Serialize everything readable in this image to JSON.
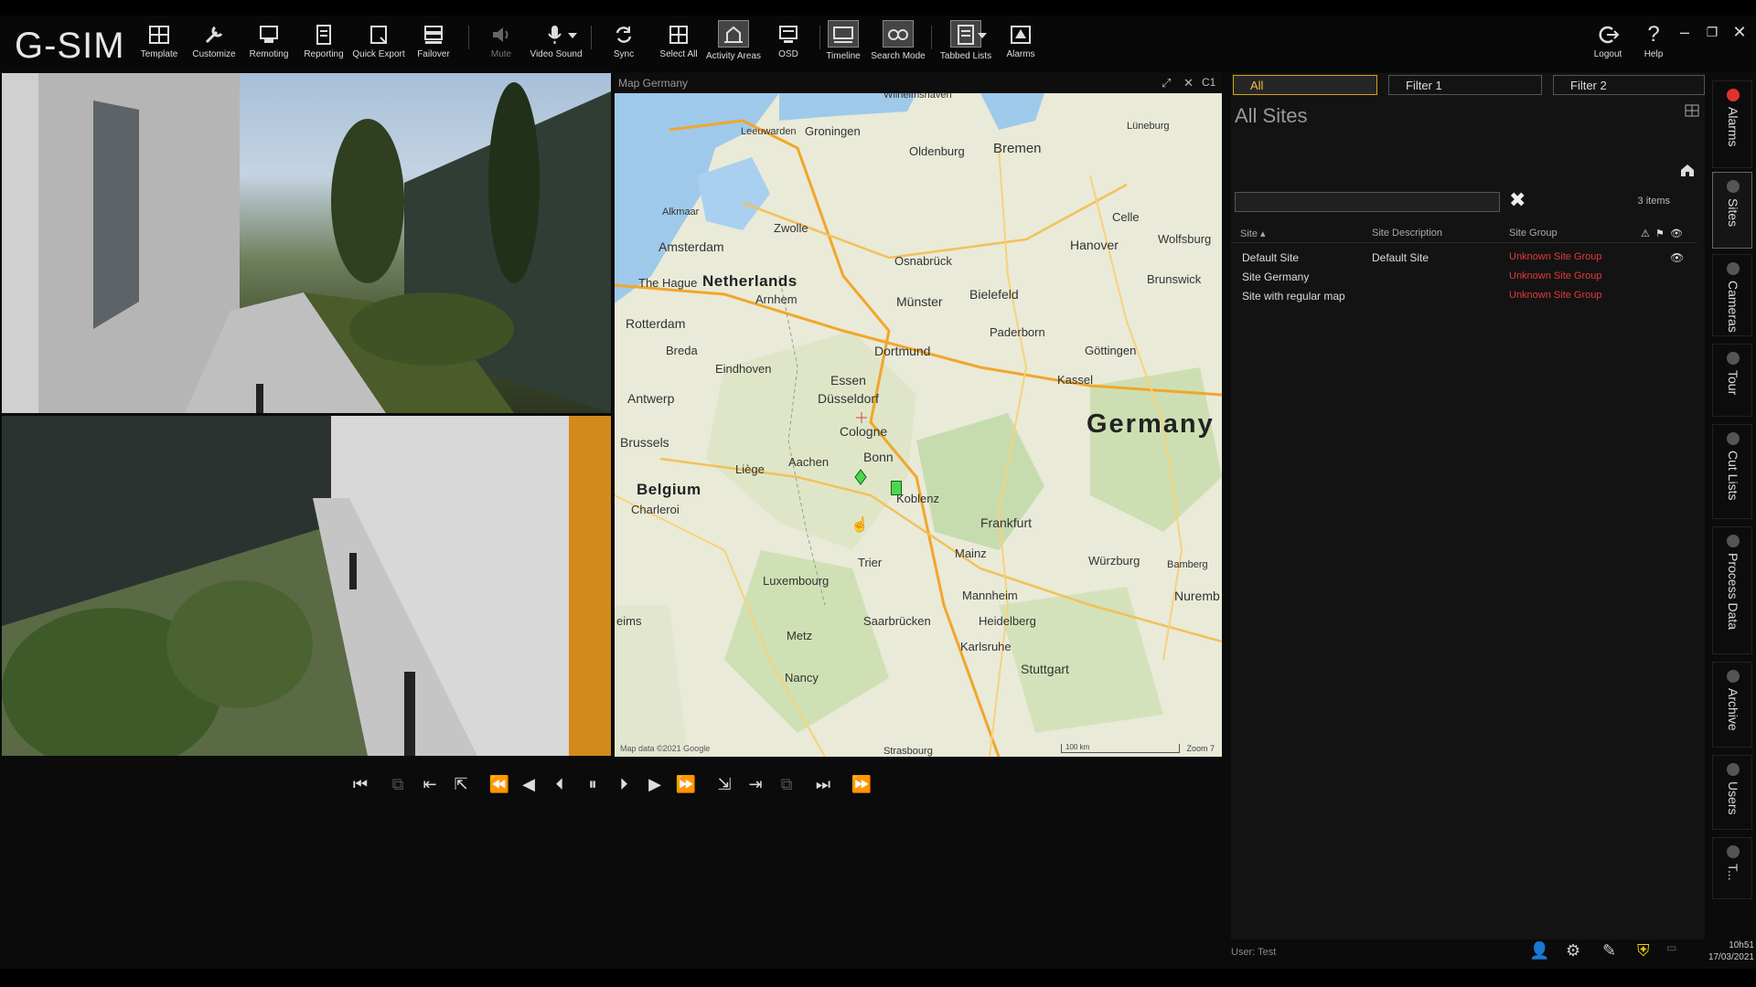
{
  "app": {
    "title": "G-SIM"
  },
  "toolbar": {
    "items": [
      {
        "label": "Template",
        "icon": "template-icon"
      },
      {
        "label": "Customize",
        "icon": "wrench-icon"
      },
      {
        "label": "Remoting",
        "icon": "remote-monitor-icon"
      },
      {
        "label": "Reporting",
        "icon": "report-icon"
      },
      {
        "label": "Quick Export",
        "icon": "export-icon"
      },
      {
        "label": "Failover",
        "icon": "failover-icon"
      },
      {
        "label": "Mute",
        "icon": "speaker-icon"
      },
      {
        "label": "Video Sound",
        "icon": "microphone-icon"
      },
      {
        "label": "Sync",
        "icon": "sync-icon"
      },
      {
        "label": "Select All",
        "icon": "grid-icon"
      },
      {
        "label": "Activity Areas",
        "icon": "activity-areas-icon"
      },
      {
        "label": "OSD",
        "icon": "osd-icon"
      },
      {
        "label": "Timeline",
        "icon": "timeline-icon"
      },
      {
        "label": "Search Mode",
        "icon": "search-mode-icon"
      },
      {
        "label": "Tabbed Lists",
        "icon": "tabbed-lists-icon"
      },
      {
        "label": "Alarms",
        "icon": "alarm-icon"
      }
    ],
    "logout": "Logout",
    "help": "Help"
  },
  "map": {
    "title": "Map Germany",
    "channel": "C1",
    "credit": "Map data ©2021 Google",
    "scale": "100 km",
    "zoom": "Zoom 7",
    "labels": {
      "wilhelmshaven": "Wilhelmshaven",
      "leeuwarden": "Leeuwarden",
      "groningen": "Groningen",
      "oldenburg": "Oldenburg",
      "bremen": "Bremen",
      "luneburg": "Lüneburg",
      "alkmaar": "Alkmaar",
      "zwolle": "Zwolle",
      "amsterdam": "Amsterdam",
      "osnabruck": "Osnabrück",
      "celle": "Celle",
      "hanover": "Hanover",
      "wolfsburg": "Wolfsburg",
      "brunswick": "Brunswick",
      "the_hague": "The Hague",
      "netherlands": "Netherlands",
      "arnhem": "Arnhem",
      "munster": "Münster",
      "bielefeld": "Bielefeld",
      "rotterdam": "Rotterdam",
      "paderborn": "Paderborn",
      "breda": "Breda",
      "eindhoven": "Eindhoven",
      "dortmund": "Dortmund",
      "gottingen": "Göttingen",
      "essen": "Essen",
      "kassel": "Kassel",
      "antwerp": "Antwerp",
      "dusseldorf": "Düsseldorf",
      "germany": "Germany",
      "cologne": "Cologne",
      "brussels": "Brussels",
      "bonn": "Bonn",
      "aachen": "Aachen",
      "liege": "Liège",
      "belgium": "Belgium",
      "charleroi": "Charleroi",
      "koblenz": "Koblenz",
      "frankfurt": "Frankfurt",
      "mainz": "Mainz",
      "wurzburg": "Würzburg",
      "bamberg": "Bamberg",
      "luxembourg": "Luxembourg",
      "trier": "Trier",
      "mannheim": "Mannheim",
      "nuremberg": "Nuremb",
      "saarbrucken": "Saarbrücken",
      "heidelberg": "Heidelberg",
      "metz": "Metz",
      "karlsruhe": "Karlsruhe",
      "stuttgart": "Stuttgart",
      "nancy": "Nancy",
      "strasbourg": "Strasbourg",
      "reims": "eims"
    }
  },
  "sites": {
    "tabs": [
      "All",
      "Filter 1",
      "Filter 2"
    ],
    "title": "All Sites",
    "search_value": "",
    "count": "3 items",
    "columns": [
      "Site ▴",
      "Site Description",
      "Site Group"
    ],
    "rows": [
      {
        "site": "Default Site",
        "description": "Default Site",
        "group": "Unknown Site Group"
      },
      {
        "site": "Site Germany",
        "description": "",
        "group": "Unknown Site Group"
      },
      {
        "site": "Site with regular map",
        "description": "",
        "group": "Unknown Site Group"
      }
    ],
    "user": "User: Test"
  },
  "side_tabs": [
    "Alarms",
    "Sites",
    "Cameras",
    "Tour",
    "Cut Lists",
    "Process Data",
    "Archive",
    "Users",
    "T..."
  ],
  "clock": {
    "time": "10h51",
    "date": "17/03/2021"
  },
  "colors": {
    "accent": "#f0c040",
    "alert": "#e23a3a",
    "pin": "#4cd84c"
  }
}
